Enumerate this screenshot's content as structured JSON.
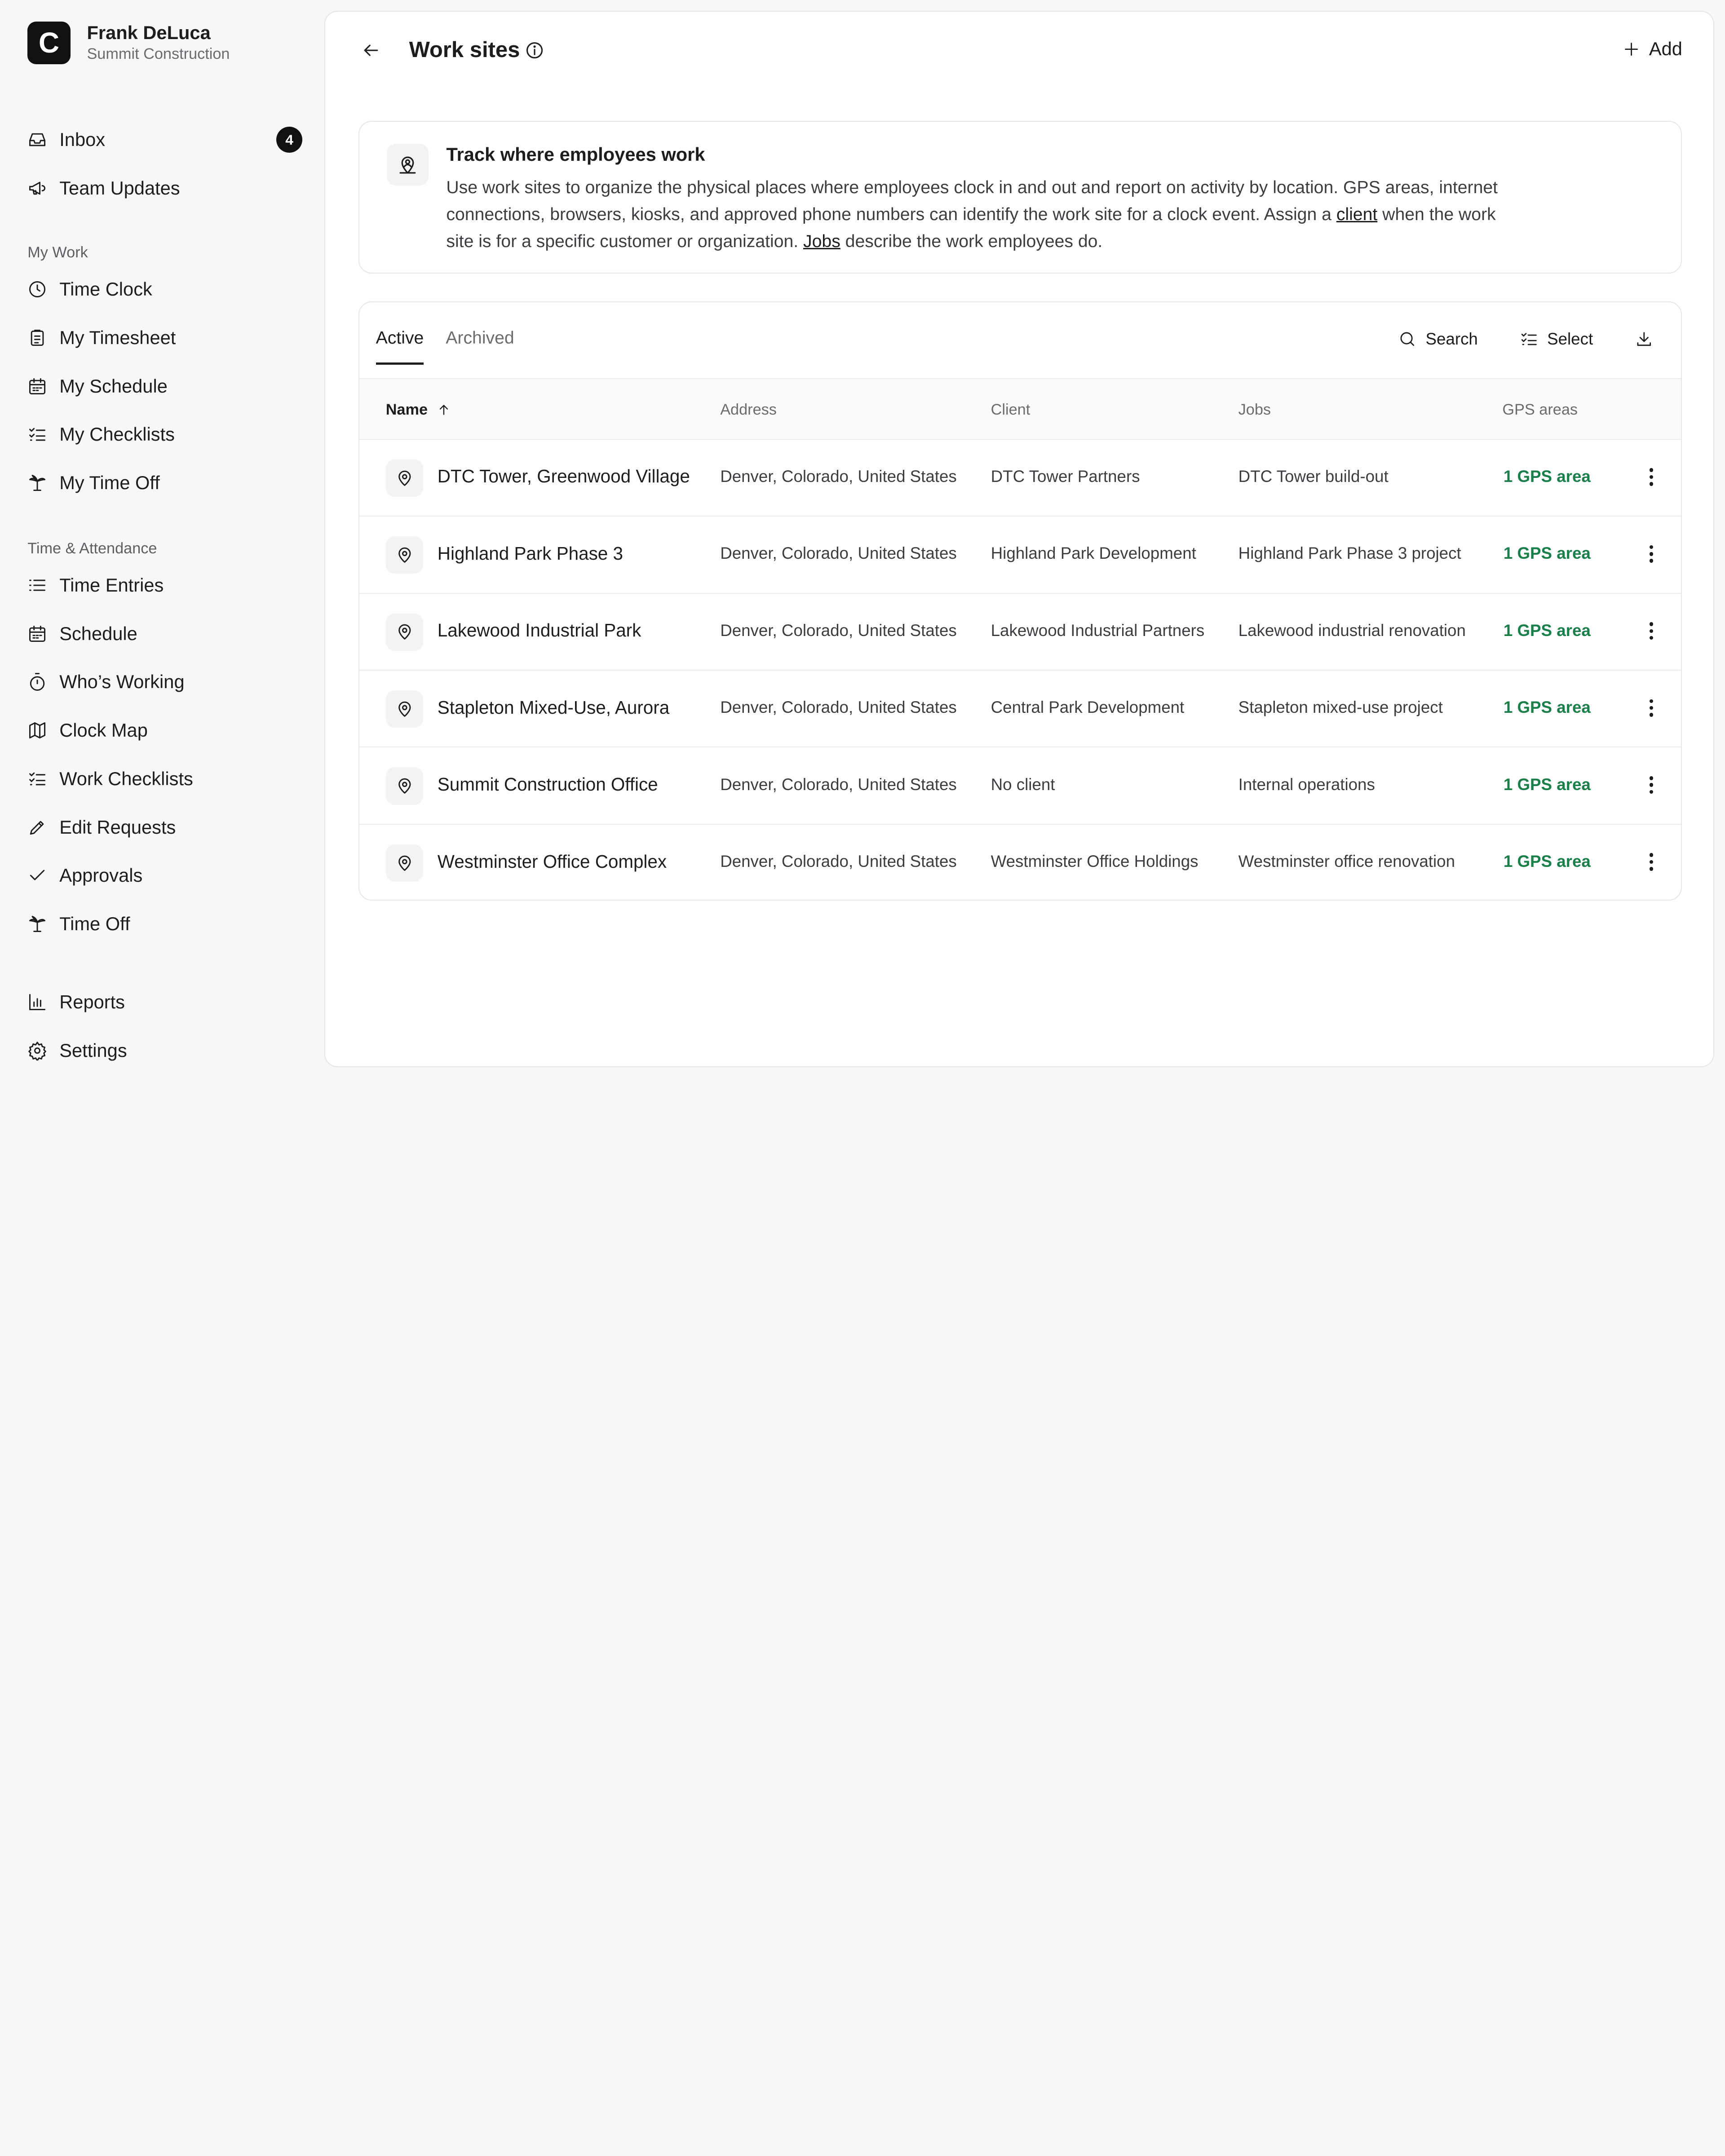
{
  "user": {
    "name": "Frank DeLuca",
    "org": "Summit Construction",
    "logo_letter": "C"
  },
  "nav": {
    "top": [
      {
        "label": "Inbox",
        "icon": "inbox-icon",
        "badge": "4"
      },
      {
        "label": "Team Updates",
        "icon": "megaphone-icon"
      }
    ],
    "my_work_label": "My Work",
    "my_work": [
      {
        "label": "Time Clock",
        "icon": "clock-icon"
      },
      {
        "label": "My Timesheet",
        "icon": "clipboard-icon"
      },
      {
        "label": "My Schedule",
        "icon": "calendar-icon"
      },
      {
        "label": "My Checklists",
        "icon": "checklist-icon"
      },
      {
        "label": "My Time Off",
        "icon": "palm-tree-icon"
      }
    ],
    "ta_label": "Time & Attendance",
    "ta": [
      {
        "label": "Time Entries",
        "icon": "list-icon"
      },
      {
        "label": "Schedule",
        "icon": "calendar-icon"
      },
      {
        "label": "Who’s Working",
        "icon": "stopwatch-icon"
      },
      {
        "label": "Clock Map",
        "icon": "map-icon"
      },
      {
        "label": "Work Checklists",
        "icon": "checklist-icon"
      },
      {
        "label": "Edit Requests",
        "icon": "pencil-icon"
      },
      {
        "label": "Approvals",
        "icon": "check-icon"
      },
      {
        "label": "Time Off",
        "icon": "palm-tree-icon"
      }
    ],
    "bottom": [
      {
        "label": "Reports",
        "icon": "bar-chart-icon"
      },
      {
        "label": "Settings",
        "icon": "gear-icon"
      }
    ]
  },
  "header": {
    "title": "Work sites",
    "add_label": "Add"
  },
  "info_card": {
    "title": "Track where employees work",
    "body_1": "Use work sites to organize the physical places where employees clock in and out and report on activity by location. GPS areas, internet connections, browsers, kiosks, and approved phone numbers can identify the work site for a clock event. Assign a ",
    "link_client": "client",
    "body_2": " when the work site is for a specific customer or organization. ",
    "link_jobs": "Jobs",
    "body_3": " describe the work employees do."
  },
  "tabs": {
    "active": "Active",
    "archived": "Archived"
  },
  "toolbar": {
    "search": "Search",
    "select": "Select"
  },
  "columns": {
    "name": "Name",
    "address": "Address",
    "client": "Client",
    "jobs": "Jobs",
    "gps": "GPS areas"
  },
  "rows": [
    {
      "name": "DTC Tower, Greenwood Village",
      "address": "Denver, Colorado, United States",
      "client": "DTC Tower Partners",
      "jobs": "DTC Tower build-out",
      "gps": "1 GPS area"
    },
    {
      "name": "Highland Park Phase 3",
      "address": "Denver, Colorado, United States",
      "client": "Highland Park Development",
      "jobs": "Highland Park Phase 3 project",
      "gps": "1 GPS area"
    },
    {
      "name": "Lakewood Industrial Park",
      "address": "Denver, Colorado, United States",
      "client": "Lakewood Industrial Partners",
      "jobs": "Lakewood industrial renovation",
      "gps": "1 GPS area"
    },
    {
      "name": "Stapleton Mixed-Use, Aurora",
      "address": "Denver, Colorado, United States",
      "client": "Central Park Development",
      "jobs": "Stapleton mixed-use project",
      "gps": "1 GPS area"
    },
    {
      "name": "Summit Construction Office",
      "address": "Denver, Colorado, United States",
      "client": "No client",
      "jobs": "Internal operations",
      "gps": "1 GPS area"
    },
    {
      "name": "Westminster Office Complex",
      "address": "Denver, Colorado, United States",
      "client": "Westminster Office Holdings",
      "jobs": "Westminster office renovation",
      "gps": "1 GPS area"
    }
  ],
  "colors": {
    "gps_green": "#1a7f4b",
    "badge_bg": "#111111"
  }
}
